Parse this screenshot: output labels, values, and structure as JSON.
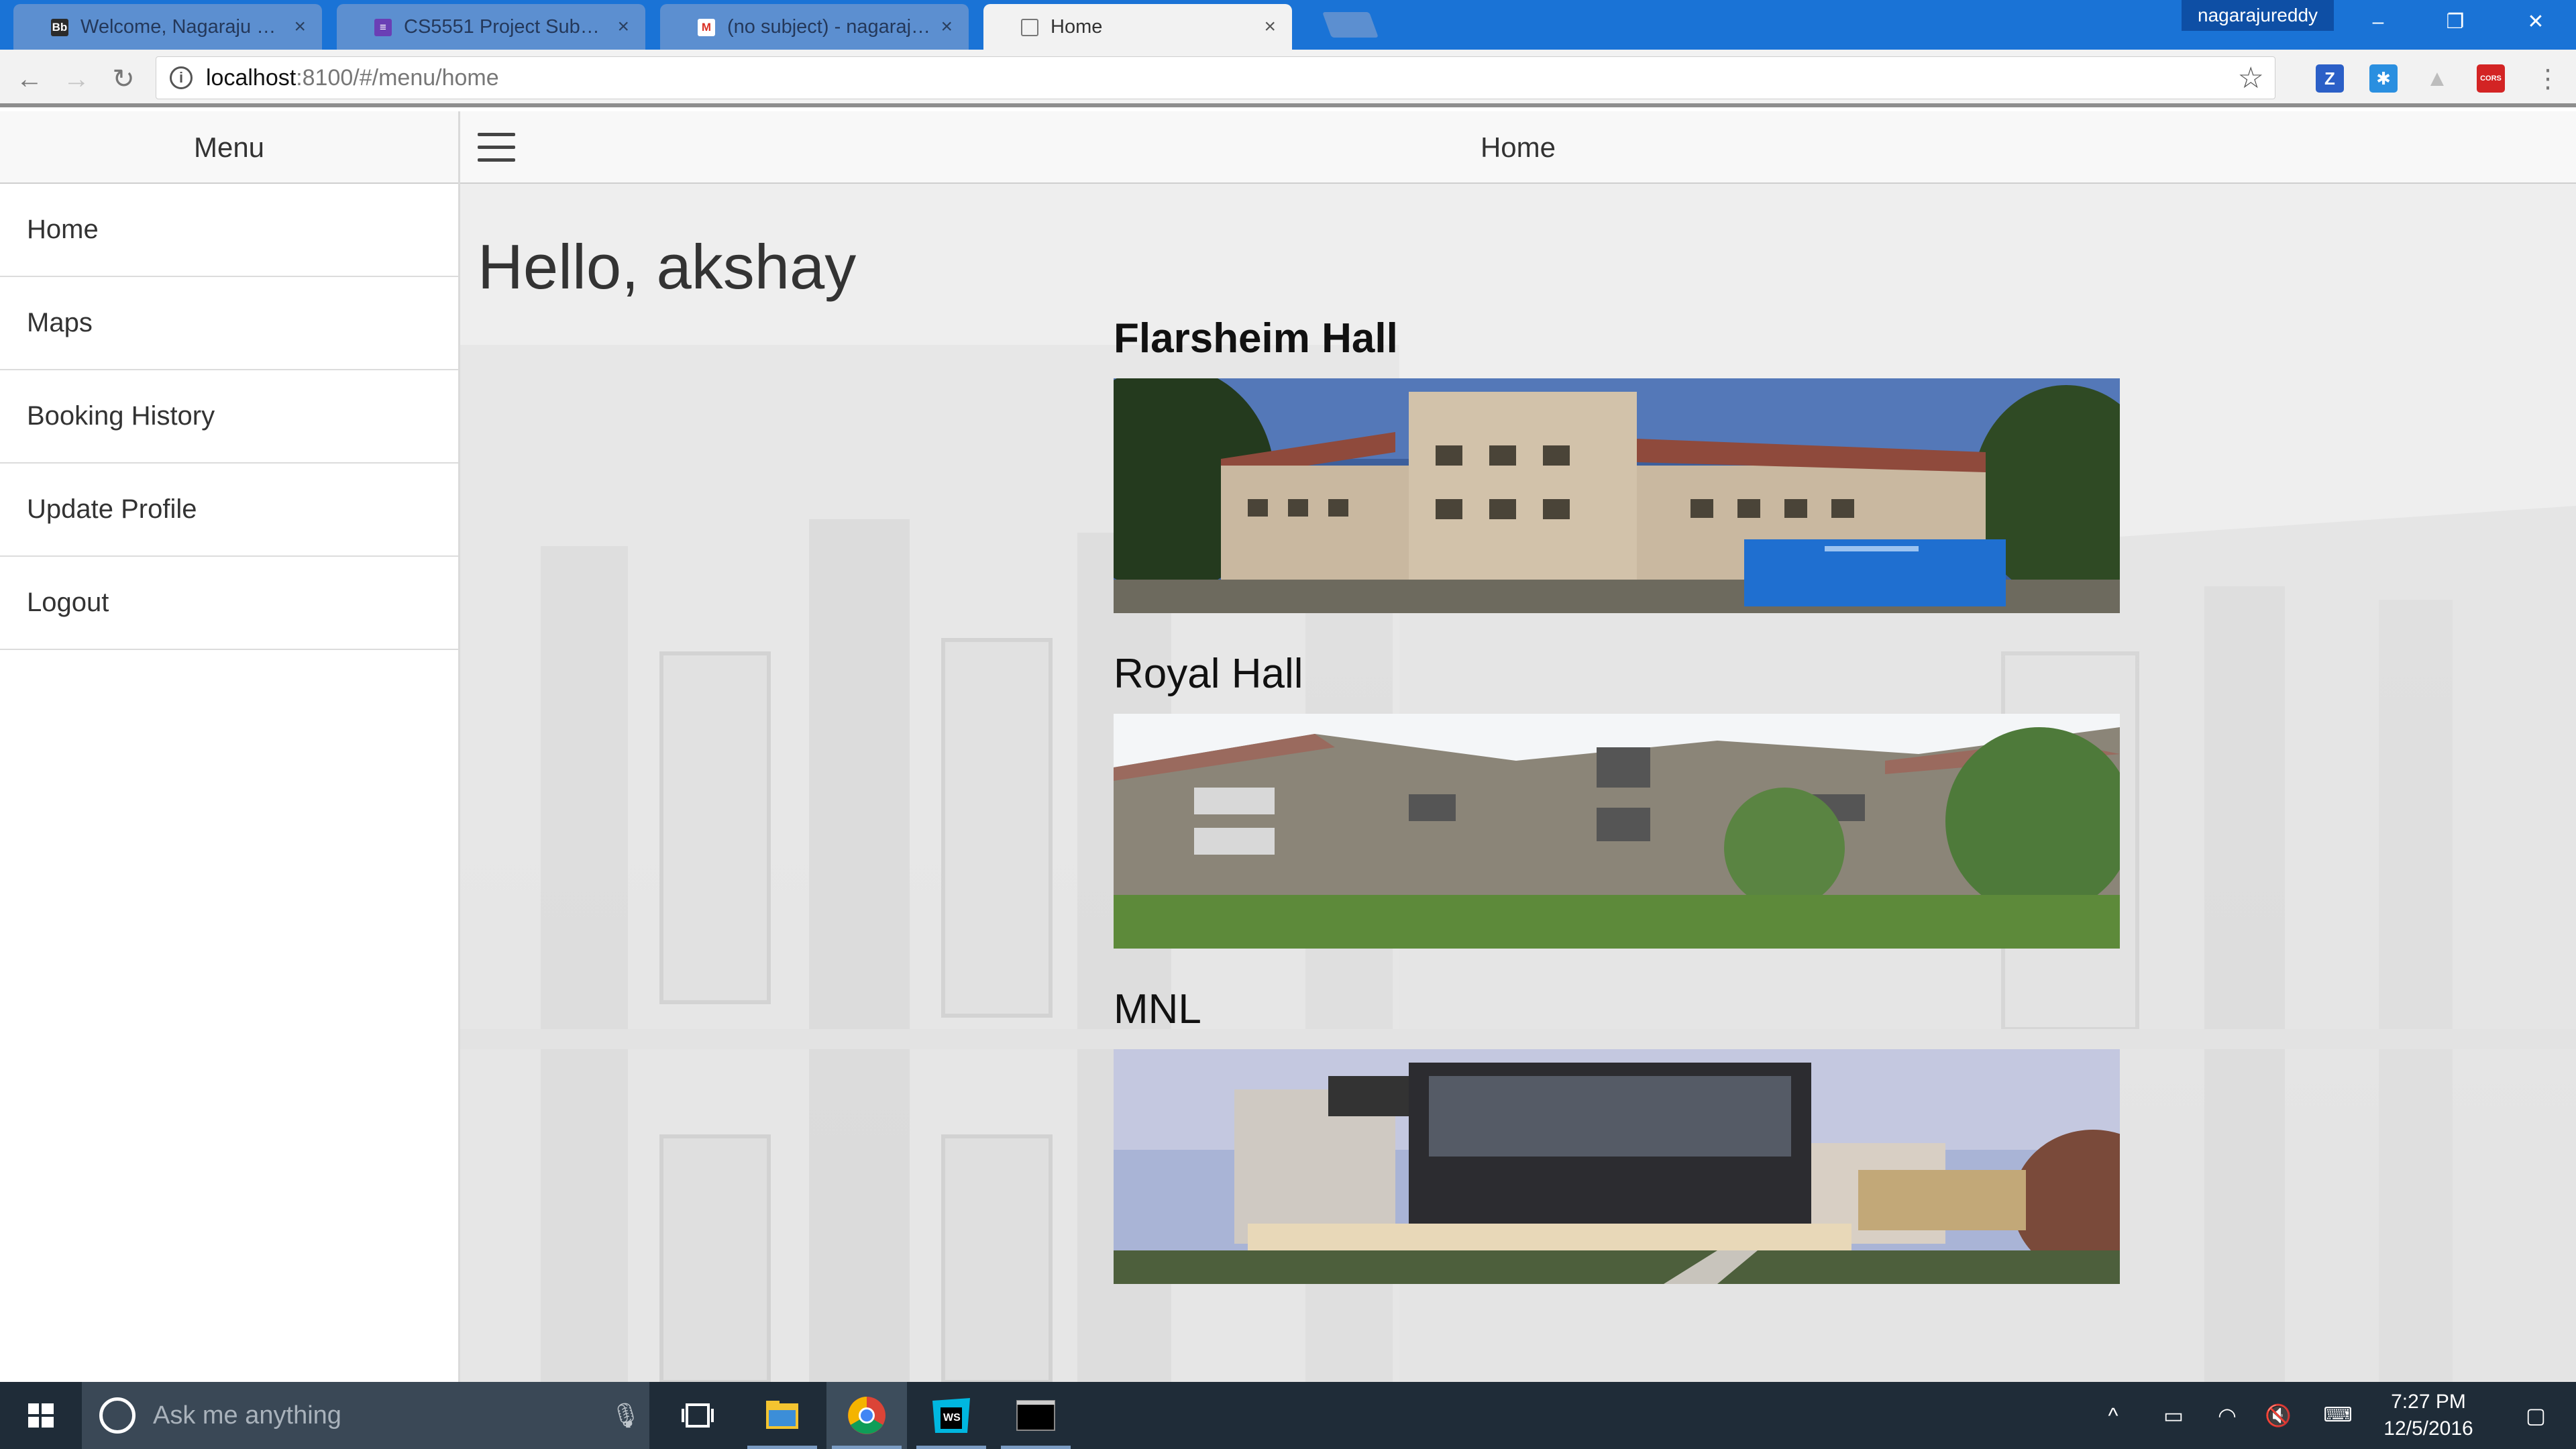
{
  "browser": {
    "tabs": [
      {
        "label": "Welcome, Nagaraju – Bla",
        "favicon": "bb-icon",
        "active": false
      },
      {
        "label": "CS5551 Project Submissio",
        "favicon": "form-icon",
        "active": false
      },
      {
        "label": "(no subject) - nagarajure",
        "favicon": "gmail-icon",
        "active": false
      },
      {
        "label": "Home",
        "favicon": "page-icon",
        "active": true
      }
    ],
    "profile_name": "nagarajureddy",
    "url_host": "localhost",
    "url_rest": ":8100/#/menu/home",
    "extensions": [
      {
        "name": "z-extension-icon",
        "glyph": "Z",
        "color": "#2b5fc7"
      },
      {
        "name": "snowflake-extension-icon",
        "glyph": "✱",
        "color": "#2a8fe0"
      },
      {
        "name": "drive-extension-icon",
        "glyph": "▲",
        "color": "#bdbdbd"
      },
      {
        "name": "cors-extension-icon",
        "glyph": "CORS",
        "color": "#d32424"
      }
    ]
  },
  "sidebar": {
    "title": "Menu",
    "items": [
      {
        "label": "Home"
      },
      {
        "label": "Maps"
      },
      {
        "label": "Booking History"
      },
      {
        "label": "Update Profile"
      },
      {
        "label": "Logout"
      }
    ]
  },
  "main": {
    "title": "Home",
    "greeting": "Hello, akshay",
    "buildings": [
      {
        "name": "Flarsheim Hall",
        "bold": true
      },
      {
        "name": "Royal Hall",
        "bold": false
      },
      {
        "name": "MNL",
        "bold": false
      }
    ]
  },
  "taskbar": {
    "search_placeholder": "Ask me anything",
    "time": "7:27 PM",
    "date": "12/5/2016"
  }
}
